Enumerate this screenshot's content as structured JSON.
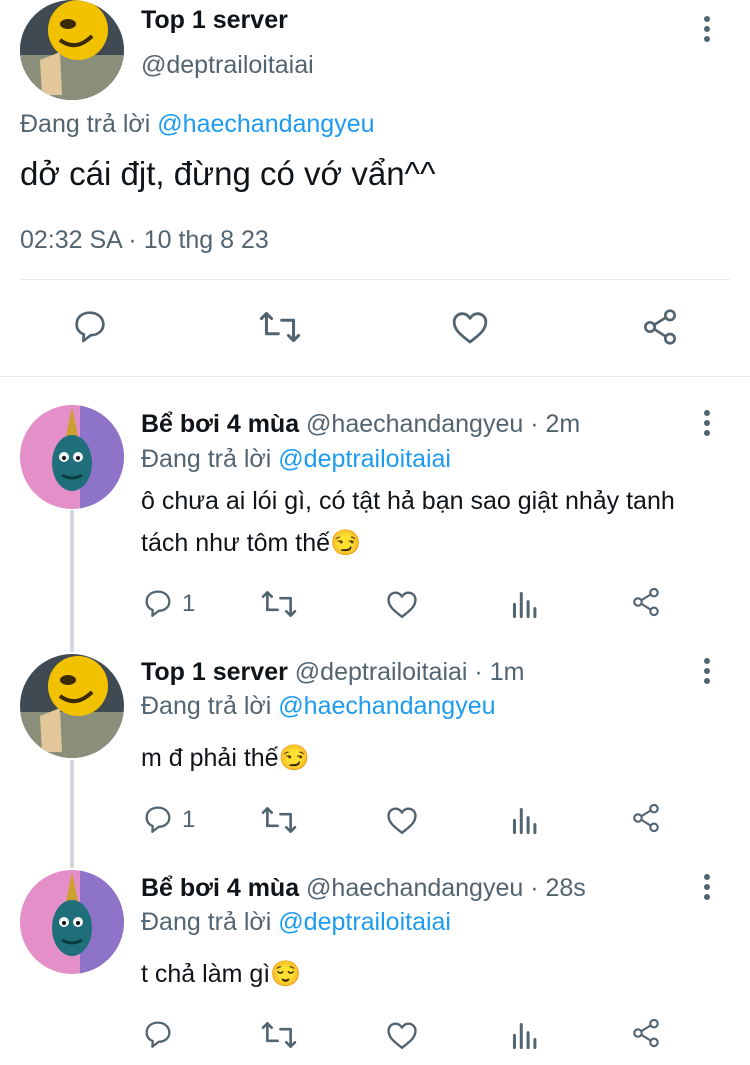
{
  "main_tweet": {
    "display_name": "Top 1 server",
    "handle": "@deptrailoitaiai",
    "replying_label": "Đang trả lời",
    "replying_to": "@haechandangyeu",
    "text": "dở cái đjt, đừng có vớ vẩn^^",
    "timestamp": "02:32 SA · 10 thg 8 23",
    "icons": [
      "reply-icon",
      "retweet-icon",
      "like-icon",
      "share-icon"
    ]
  },
  "replies": [
    {
      "display_name": "Bể bơi 4 mùa",
      "handle_time": "@haechandangyeu · 2m",
      "replying_label": "Đang trả lời",
      "replying_to": "@deptrailoitaiai",
      "text": "ô chưa ai lói gì, có tật hả bạn sao giật nhảy tanh tách như tôm thế😏",
      "reply_count": "1"
    },
    {
      "display_name": "Top 1 server",
      "handle_time": "@deptrailoitaiai · 1m",
      "replying_label": "Đang trả lời",
      "replying_to": "@haechandangyeu",
      "text": "m đ phải thế😏",
      "reply_count": "1"
    },
    {
      "display_name": "Bể bơi 4 mùa",
      "handle_time": "@haechandangyeu · 28s",
      "replying_label": "Đang trả lời",
      "replying_to": "@deptrailoitaiai",
      "text": "t chả làm gì😌",
      "reply_count": ""
    }
  ],
  "colors": {
    "link": "#1d9bf0",
    "muted": "#536471",
    "divider": "#e6ecf0",
    "thread_line": "#cfd9de"
  }
}
